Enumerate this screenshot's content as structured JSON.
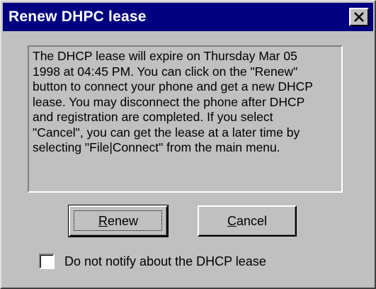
{
  "window": {
    "title": "Renew DHPC lease",
    "close_glyph": "×"
  },
  "message": "The DHCP lease will expire on Thursday Mar 05\n1998 at 04:45 PM. You can click on the \"Renew\"\nbutton to connect your phone and get a new DHCP\nlease. You may disconnect the phone after DHCP\nand registration are completed. If you select\n\"Cancel\", you can get the lease at a later time by\nselecting \"File|Connect\" from the main menu.",
  "buttons": {
    "renew": {
      "accel": "R",
      "rest": "enew"
    },
    "cancel": {
      "accel": "C",
      "rest": "ancel"
    }
  },
  "checkbox": {
    "label": "Do not notify about the DHCP lease",
    "checked": false
  },
  "colors": {
    "title_bar": "#000080",
    "face": "#c0c0c0"
  },
  "icons": {
    "close": "close-icon"
  }
}
